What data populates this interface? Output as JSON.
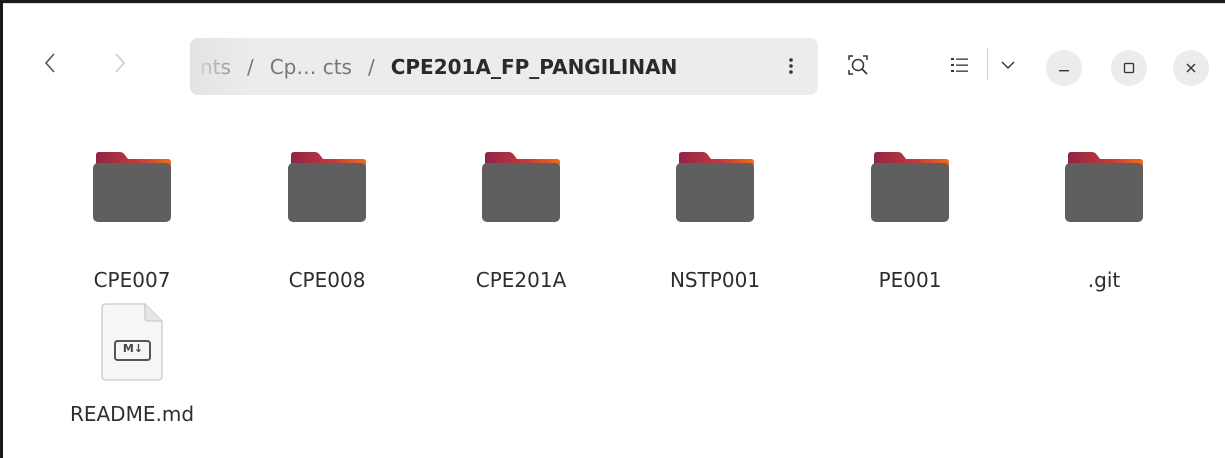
{
  "header": {
    "back_icon": "chevron-left-icon",
    "forward_icon": "chevron-right-icon",
    "path": {
      "segments": [
        "nts",
        "Cp… cts",
        "CPE201A_FP_PANGILINAN"
      ],
      "separator": "/",
      "menu_icon": "vertical-ellipsis-icon"
    },
    "search_icon": "search-icon",
    "view_icon": "list-view-icon",
    "view_options_icon": "chevron-down-icon",
    "window_controls": [
      "minimize-icon",
      "maximize-icon",
      "close-icon"
    ]
  },
  "files": [
    {
      "name": "CPE007",
      "type": "folder"
    },
    {
      "name": "CPE008",
      "type": "folder"
    },
    {
      "name": "CPE201A",
      "type": "folder"
    },
    {
      "name": "NSTP001",
      "type": "folder"
    },
    {
      "name": "PE001",
      "type": "folder"
    },
    {
      "name": ".git",
      "type": "folder"
    },
    {
      "name": "README.md",
      "type": "markdown",
      "badge": "M↓"
    }
  ],
  "colors": {
    "folder_body": "#5f5f5f",
    "folder_tab_start": "#9c2a4a",
    "folder_tab_end": "#e8611a",
    "pathbar_bg": "#ececec"
  }
}
